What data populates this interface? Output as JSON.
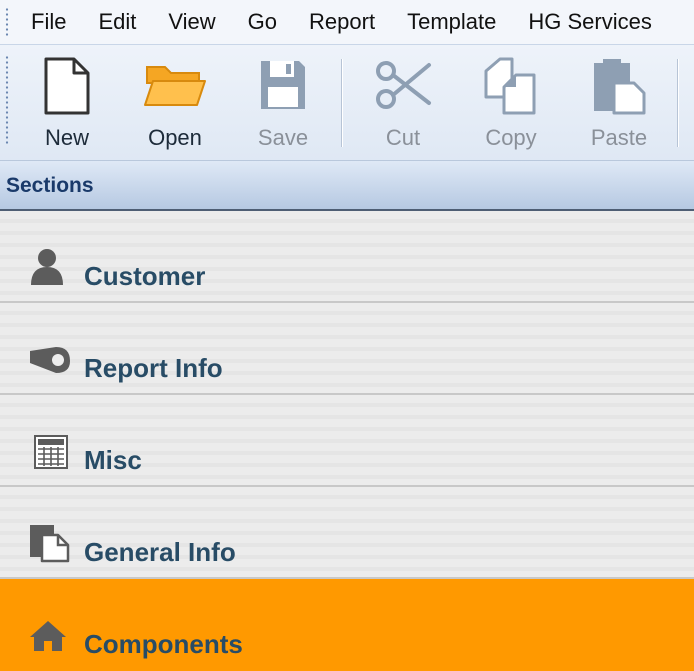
{
  "menu": {
    "items": [
      "File",
      "Edit",
      "View",
      "Go",
      "Report",
      "Template",
      "HG Services"
    ]
  },
  "toolbar": {
    "buttons": [
      {
        "label": "New",
        "icon": "new-document-icon",
        "enabled": true
      },
      {
        "label": "Open",
        "icon": "open-folder-icon",
        "enabled": true
      },
      {
        "label": "Save",
        "icon": "save-floppy-icon",
        "enabled": false
      },
      {
        "label": "Cut",
        "icon": "scissors-icon",
        "enabled": false
      },
      {
        "label": "Copy",
        "icon": "copy-icon",
        "enabled": false
      },
      {
        "label": "Paste",
        "icon": "paste-icon",
        "enabled": false
      }
    ]
  },
  "sections": {
    "title": "Sections",
    "items": [
      {
        "label": "Customer",
        "icon": "person-icon"
      },
      {
        "label": "Report Info",
        "icon": "tag-icon"
      },
      {
        "label": "Misc",
        "icon": "calculator-icon"
      },
      {
        "label": "General Info",
        "icon": "documents-icon"
      },
      {
        "label": "Components",
        "icon": "house-icon",
        "selected": true
      }
    ]
  },
  "colors": {
    "selected_section": "#ff9900",
    "section_label": "#284c66",
    "header_text": "#1a3a6a"
  }
}
